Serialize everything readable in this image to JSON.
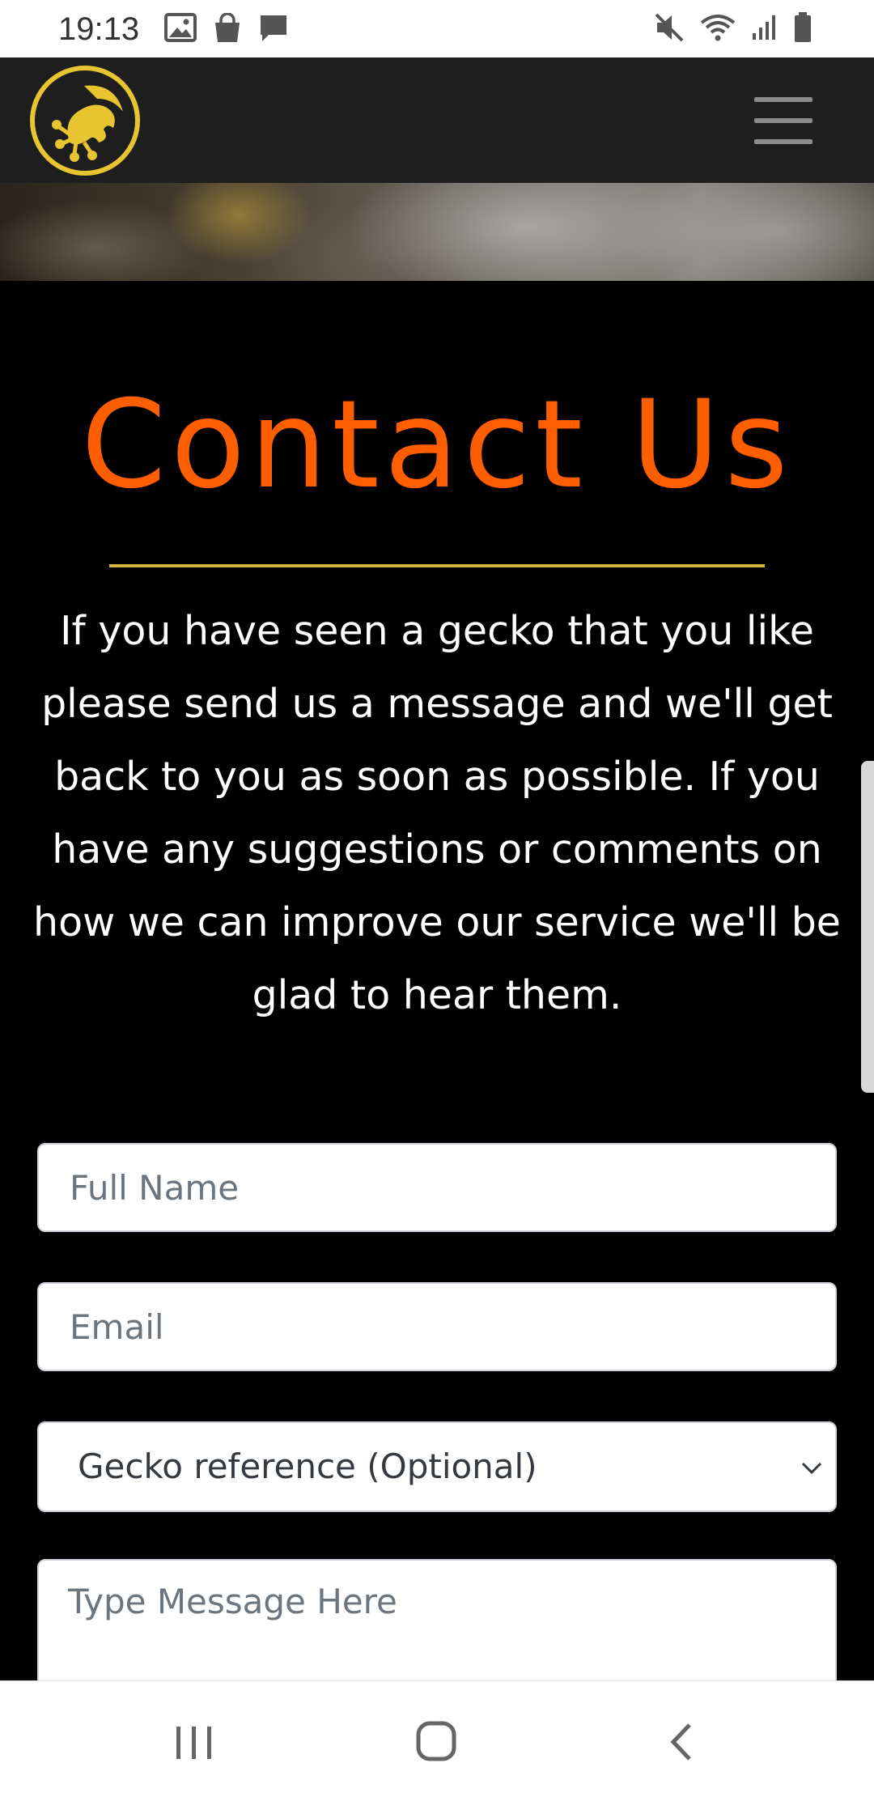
{
  "status_bar": {
    "time": "19:13",
    "left_icons": [
      "gallery-icon",
      "shopping-bag-icon",
      "message-icon"
    ],
    "right_icons": [
      "mute-icon",
      "wifi-icon",
      "signal-icon",
      "battery-icon"
    ]
  },
  "navbar": {
    "logo_icon": "gecko-foot-logo-icon",
    "menu_icon": "hamburger-menu-icon"
  },
  "contact": {
    "title": "Contact Us",
    "intro": "If you have seen a gecko that you like please send us a message and we'll get back to you as soon as possible. If you have any suggestions or comments on how we can improve our service we'll be glad to hear them."
  },
  "form": {
    "full_name": {
      "placeholder": "Full Name",
      "value": ""
    },
    "email": {
      "placeholder": "Email",
      "value": ""
    },
    "gecko_reference": {
      "selected": "Gecko reference (Optional)"
    },
    "message": {
      "placeholder": "Type Message Here",
      "value": ""
    }
  },
  "system_nav": {
    "recents_icon": "recents-icon",
    "home_icon": "home-icon",
    "back_icon": "back-icon"
  },
  "colors": {
    "title": "#ff5e00",
    "accent_rule": "#d4b43c",
    "navbar_bg": "#1e1e1e",
    "page_bg": "#000000",
    "logo": "#e8c530"
  }
}
